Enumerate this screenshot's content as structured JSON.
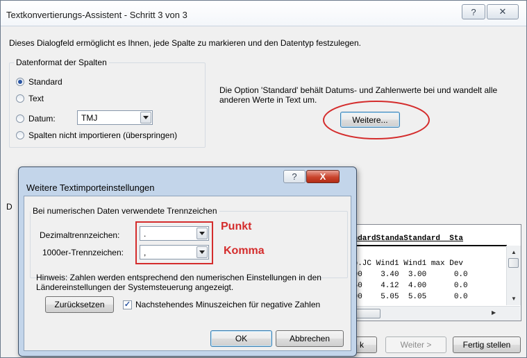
{
  "main": {
    "title": "Textkonvertierungs-Assistent - Schritt 3 von 3",
    "help_glyph": "?",
    "close_glyph": "✕",
    "intro": "Dieses Dialogfeld ermöglicht es Ihnen, jede Spalte zu markieren und den Datentyp festzulegen.",
    "format_group": {
      "legend": "Datenformat der Spalten",
      "options": [
        {
          "label": "Standard",
          "checked": true
        },
        {
          "label": "Text",
          "checked": false
        },
        {
          "label": "Datum:",
          "checked": false
        },
        {
          "label": "Spalten nicht importieren (überspringen)",
          "checked": false
        }
      ],
      "date_format": "TMJ"
    },
    "hint": "Die Option 'Standard' behält Datums- und Zahlenwerte bei und wandelt alle anderen Werte in Text um.",
    "weitere_button": "Weitere...",
    "preview_label": "D",
    "preview": {
      "header": "andardStandaStandard  Sta",
      "rows": [
        "mp.JC Wind1 Wind1 max Dev",
        ".00    3.40  3.00      0.0",
        ".50    4.12  4.00      0.0",
        ".00    5.05  5.05      0.0"
      ]
    },
    "buttons": {
      "back": "k",
      "next": "Weiter >",
      "finish": "Fertig stellen"
    }
  },
  "overlay": {
    "title": "Weitere Textimporteinstellungen",
    "help_glyph": "?",
    "close_glyph": "X",
    "group_legend": "Bei numerischen Daten verwendete Trennzeichen",
    "decimal_label": "Dezimaltrennzeichen:",
    "decimal_value": ".",
    "thousands_label": "1000er-Trennzeichen:",
    "thousands_value": ",",
    "note": "Hinweis: Zahlen werden entsprechend den numerischen Einstellungen in den Ländereinstellungen der Systemsteuerung angezeigt.",
    "reset_button": "Zurücksetzen",
    "minus_checkbox_label": "Nachstehendes Minuszeichen für negative Zahlen",
    "minus_checked": true,
    "ok_button": "OK",
    "cancel_button": "Abbrechen"
  },
  "annotations": {
    "punkt": "Punkt",
    "komma": "Komma"
  },
  "colors": {
    "annotation": "#d42c2c",
    "titlebar_overlay": "#c3d5ea",
    "dialog_bg": "#f0f0f0"
  }
}
